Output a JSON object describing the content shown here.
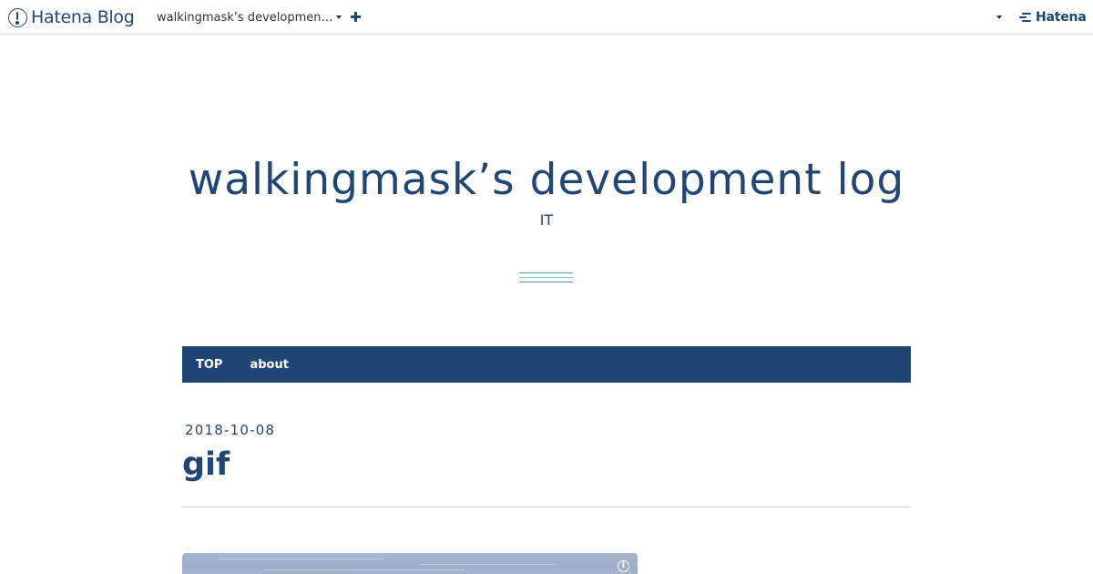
{
  "toolbar": {
    "logo_text": "Hatena Blog",
    "blog_switcher_label": "walkingmask’s developmen…",
    "add_icon": "plus-icon",
    "user_menu_icon": "caret-down-icon",
    "hatena_text": "Hatena"
  },
  "header": {
    "title": "walkingmask’s development log",
    "description": "IT"
  },
  "nav": {
    "items": [
      {
        "label": "TOP"
      },
      {
        "label": "about"
      }
    ]
  },
  "entry": {
    "date": "2018-10-08",
    "title": "gif",
    "image_info_icon": "info-icon"
  },
  "colors": {
    "brand": "#1f4675",
    "nav_background": "#1f4675",
    "accent_lines": "#5a9fa0",
    "divider": "#cccccc"
  }
}
